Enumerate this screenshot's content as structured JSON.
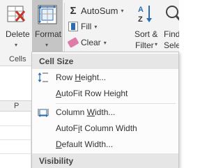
{
  "ribbon": {
    "delete": {
      "label": "Delete",
      "icon": "delete-cells-icon"
    },
    "format": {
      "label": "Format",
      "icon": "format-cells-icon"
    },
    "cells_group_label": "Cells",
    "autosum": {
      "label": "AutoSum",
      "icon": "sigma-icon"
    },
    "fill": {
      "label": "Fill",
      "icon": "fill-down-icon"
    },
    "clear": {
      "label": "Clear",
      "icon": "eraser-icon"
    },
    "sort_filter": {
      "label_line1": "Sort &",
      "label_line2": "Filter",
      "icon": "sort-az-icon"
    },
    "find_select": {
      "label_line1": "Find",
      "label_line2": "Selec",
      "icon": "find-icon"
    }
  },
  "sheet": {
    "column_header": "P"
  },
  "menu": {
    "sections": [
      {
        "header": "Cell Size"
      },
      {
        "header": "Visibility"
      }
    ],
    "items": [
      {
        "pre": "Row ",
        "ul": "H",
        "post": "eight...",
        "icon": "row-height-icon"
      },
      {
        "pre": "",
        "ul": "A",
        "post": "utoFit Row Height",
        "icon": ""
      },
      {
        "pre": "Column ",
        "ul": "W",
        "post": "idth...",
        "icon": "column-width-icon"
      },
      {
        "pre": "AutoF",
        "ul": "i",
        "post": "t Column Width",
        "icon": ""
      },
      {
        "pre": "",
        "ul": "D",
        "post": "efault Width...",
        "icon": ""
      }
    ]
  },
  "colors": {
    "ribbon_bg": "#f3f3f3",
    "format_pressed": "#c5c5c5",
    "menu_header_bg": "#e6e6e6",
    "icon_blue": "#2b6cb0",
    "icon_red": "#c0392b"
  }
}
